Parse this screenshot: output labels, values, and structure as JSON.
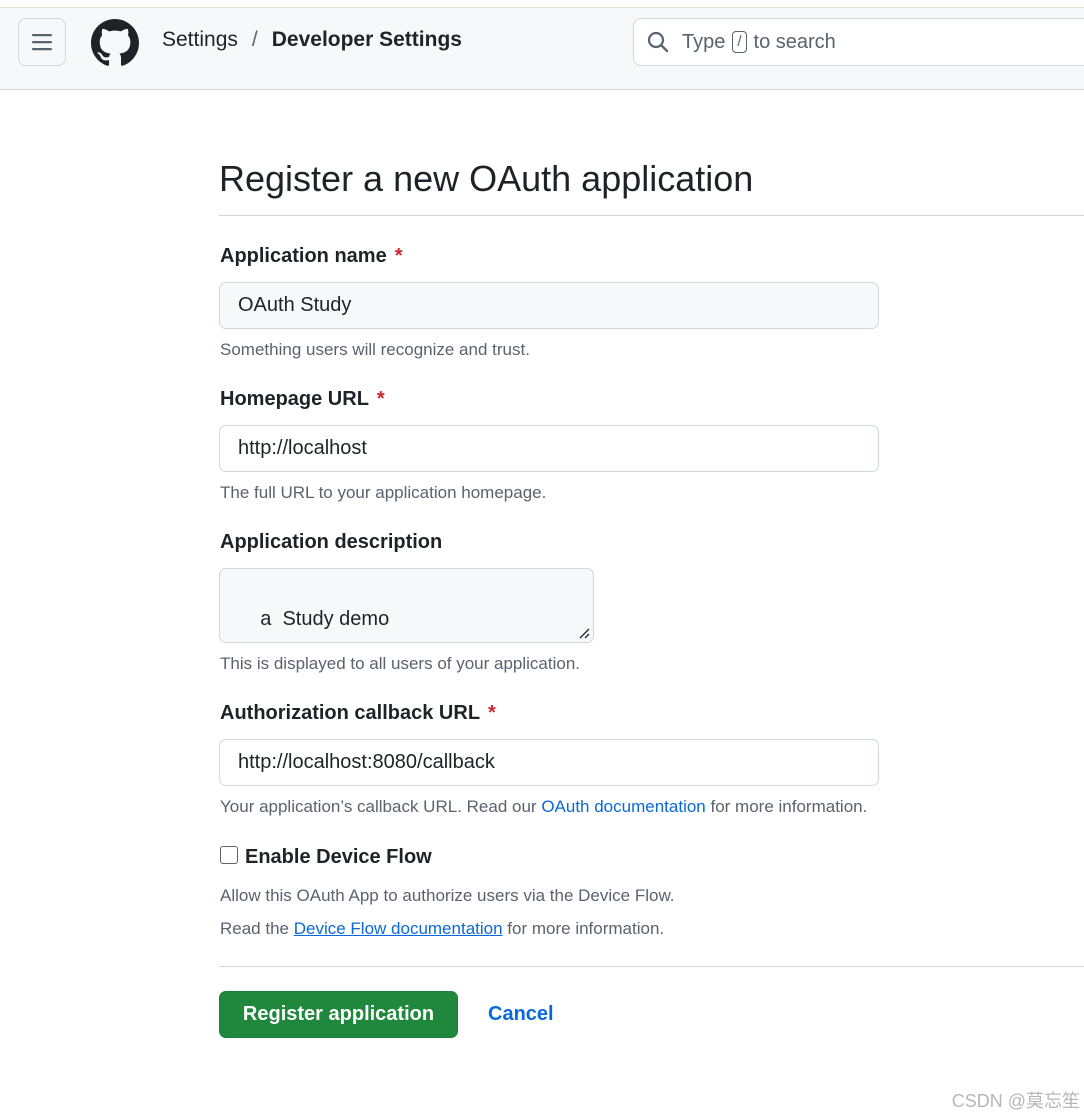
{
  "header": {
    "breadcrumb_parent": "Settings",
    "breadcrumb_separator": "/",
    "breadcrumb_current": "Developer Settings",
    "search": {
      "prefix": "Type",
      "shortcut": "/",
      "suffix": "to search"
    }
  },
  "page": {
    "title": "Register a new OAuth application"
  },
  "form": {
    "app_name": {
      "label": "Application name",
      "required_marker": "*",
      "value": "OAuth Study",
      "hint": "Something users will recognize and trust."
    },
    "homepage_url": {
      "label": "Homepage URL",
      "required_marker": "*",
      "value": "http://localhost",
      "hint": "The full URL to your application homepage."
    },
    "description": {
      "label": "Application description",
      "value": "a  Study demo",
      "hint": "This is displayed to all users of your application."
    },
    "callback_url": {
      "label": "Authorization callback URL",
      "required_marker": "*",
      "value": "http://localhost:8080/callback",
      "hint_before": "Your application’s callback URL. Read our",
      "hint_link": "OAuth documentation",
      "hint_after": "for more information."
    },
    "device_flow": {
      "label": "Enable Device Flow",
      "checked": false,
      "hint_line1": "Allow this OAuth App to authorize users via the Device Flow.",
      "hint_line2_before": "Read the",
      "hint_line2_link": "Device Flow documentation",
      "hint_line2_after": "for more information."
    }
  },
  "actions": {
    "register_label": "Register application",
    "cancel_label": "Cancel"
  },
  "watermark": "CSDN @莫忘笙",
  "colors": {
    "primary_button": "#1f883d",
    "link": "#0969da",
    "required": "#d1242f",
    "muted_text": "#59636e",
    "border": "#d0d7de"
  },
  "icons": [
    "hamburger-menu-icon",
    "github-logo-icon",
    "search-icon",
    "resize-grip-icon"
  ]
}
